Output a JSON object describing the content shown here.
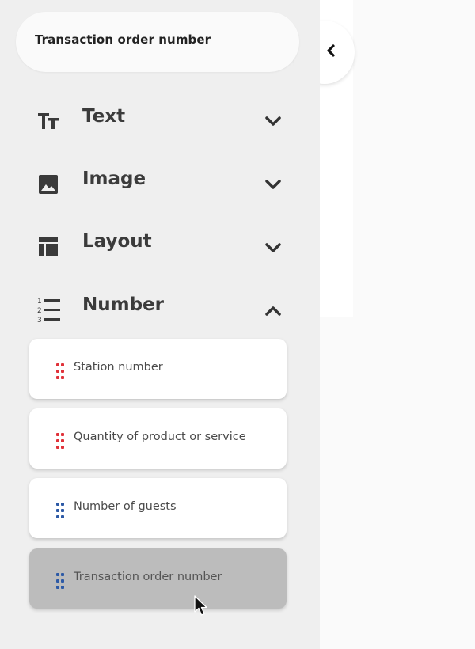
{
  "sidebar": {
    "search": {
      "value": "Transaction order number"
    },
    "categories": [
      {
        "label": "Text",
        "icon": "text-size-icon",
        "expanded": false
      },
      {
        "label": "Image",
        "icon": "image-icon",
        "expanded": false
      },
      {
        "label": "Layout",
        "icon": "layout-icon",
        "expanded": false
      },
      {
        "label": "Number",
        "icon": "numbered-list-icon",
        "expanded": true
      }
    ],
    "number_fields": [
      {
        "label": "Station number",
        "handle_color": "#e0323a",
        "active": false
      },
      {
        "label": "Quantity of product or service",
        "handle_color": "#e0323a",
        "active": false
      },
      {
        "label": "Number of guests",
        "handle_color": "#2d5aa6",
        "active": false
      },
      {
        "label": "Transaction order number",
        "handle_color": "#2d5aa6",
        "active": true
      }
    ]
  },
  "colors": {
    "sidebar_bg": "#efefef",
    "card_bg": "#ffffff",
    "card_active_bg": "#bcbcbc",
    "icon_dark": "#3a3a3a",
    "handle_red": "#e0323a",
    "handle_blue": "#2d5aa6"
  }
}
